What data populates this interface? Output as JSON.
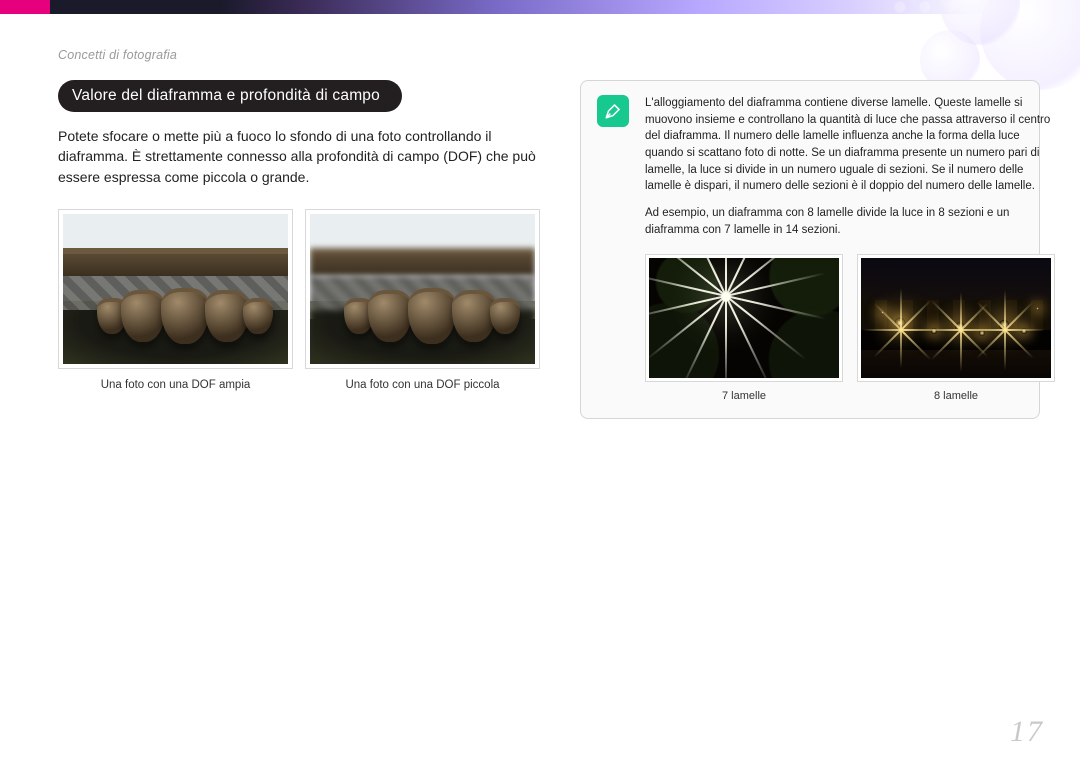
{
  "breadcrumb": "Concetti di fotografia",
  "heading": "Valore del diaframma e profondità di campo",
  "body": "Potete sfocare o mette più a fuoco lo sfondo di una foto controllando il diaframma. È strettamente connesso alla profondità di campo (DOF) che può essere espressa come piccola o grande.",
  "figs_left": [
    {
      "caption": "Una foto con una DOF ampia"
    },
    {
      "caption": "Una foto con una DOF piccola"
    }
  ],
  "info": {
    "icon_name": "pen-icon",
    "p1": "L'alloggiamento del diaframma contiene diverse lamelle. Queste lamelle si muovono insieme e controllano la quantità di luce che passa attraverso il centro del diaframma. Il numero delle lamelle influenza anche la forma della luce quando si scattano foto di notte. Se un diaframma presente un numero pari di lamelle, la luce si divide in un numero uguale di sezioni. Se il numero delle lamelle è dispari, il numero delle sezioni è il doppio del numero delle lamelle.",
    "p2": "Ad esempio, un diaframma con 8 lamelle divide la luce in 8 sezioni e un diaframma con 7 lamelle in 14 sezioni.",
    "figs": [
      {
        "caption": "7 lamelle"
      },
      {
        "caption": "8 lamelle"
      }
    ]
  },
  "page_number": "17"
}
